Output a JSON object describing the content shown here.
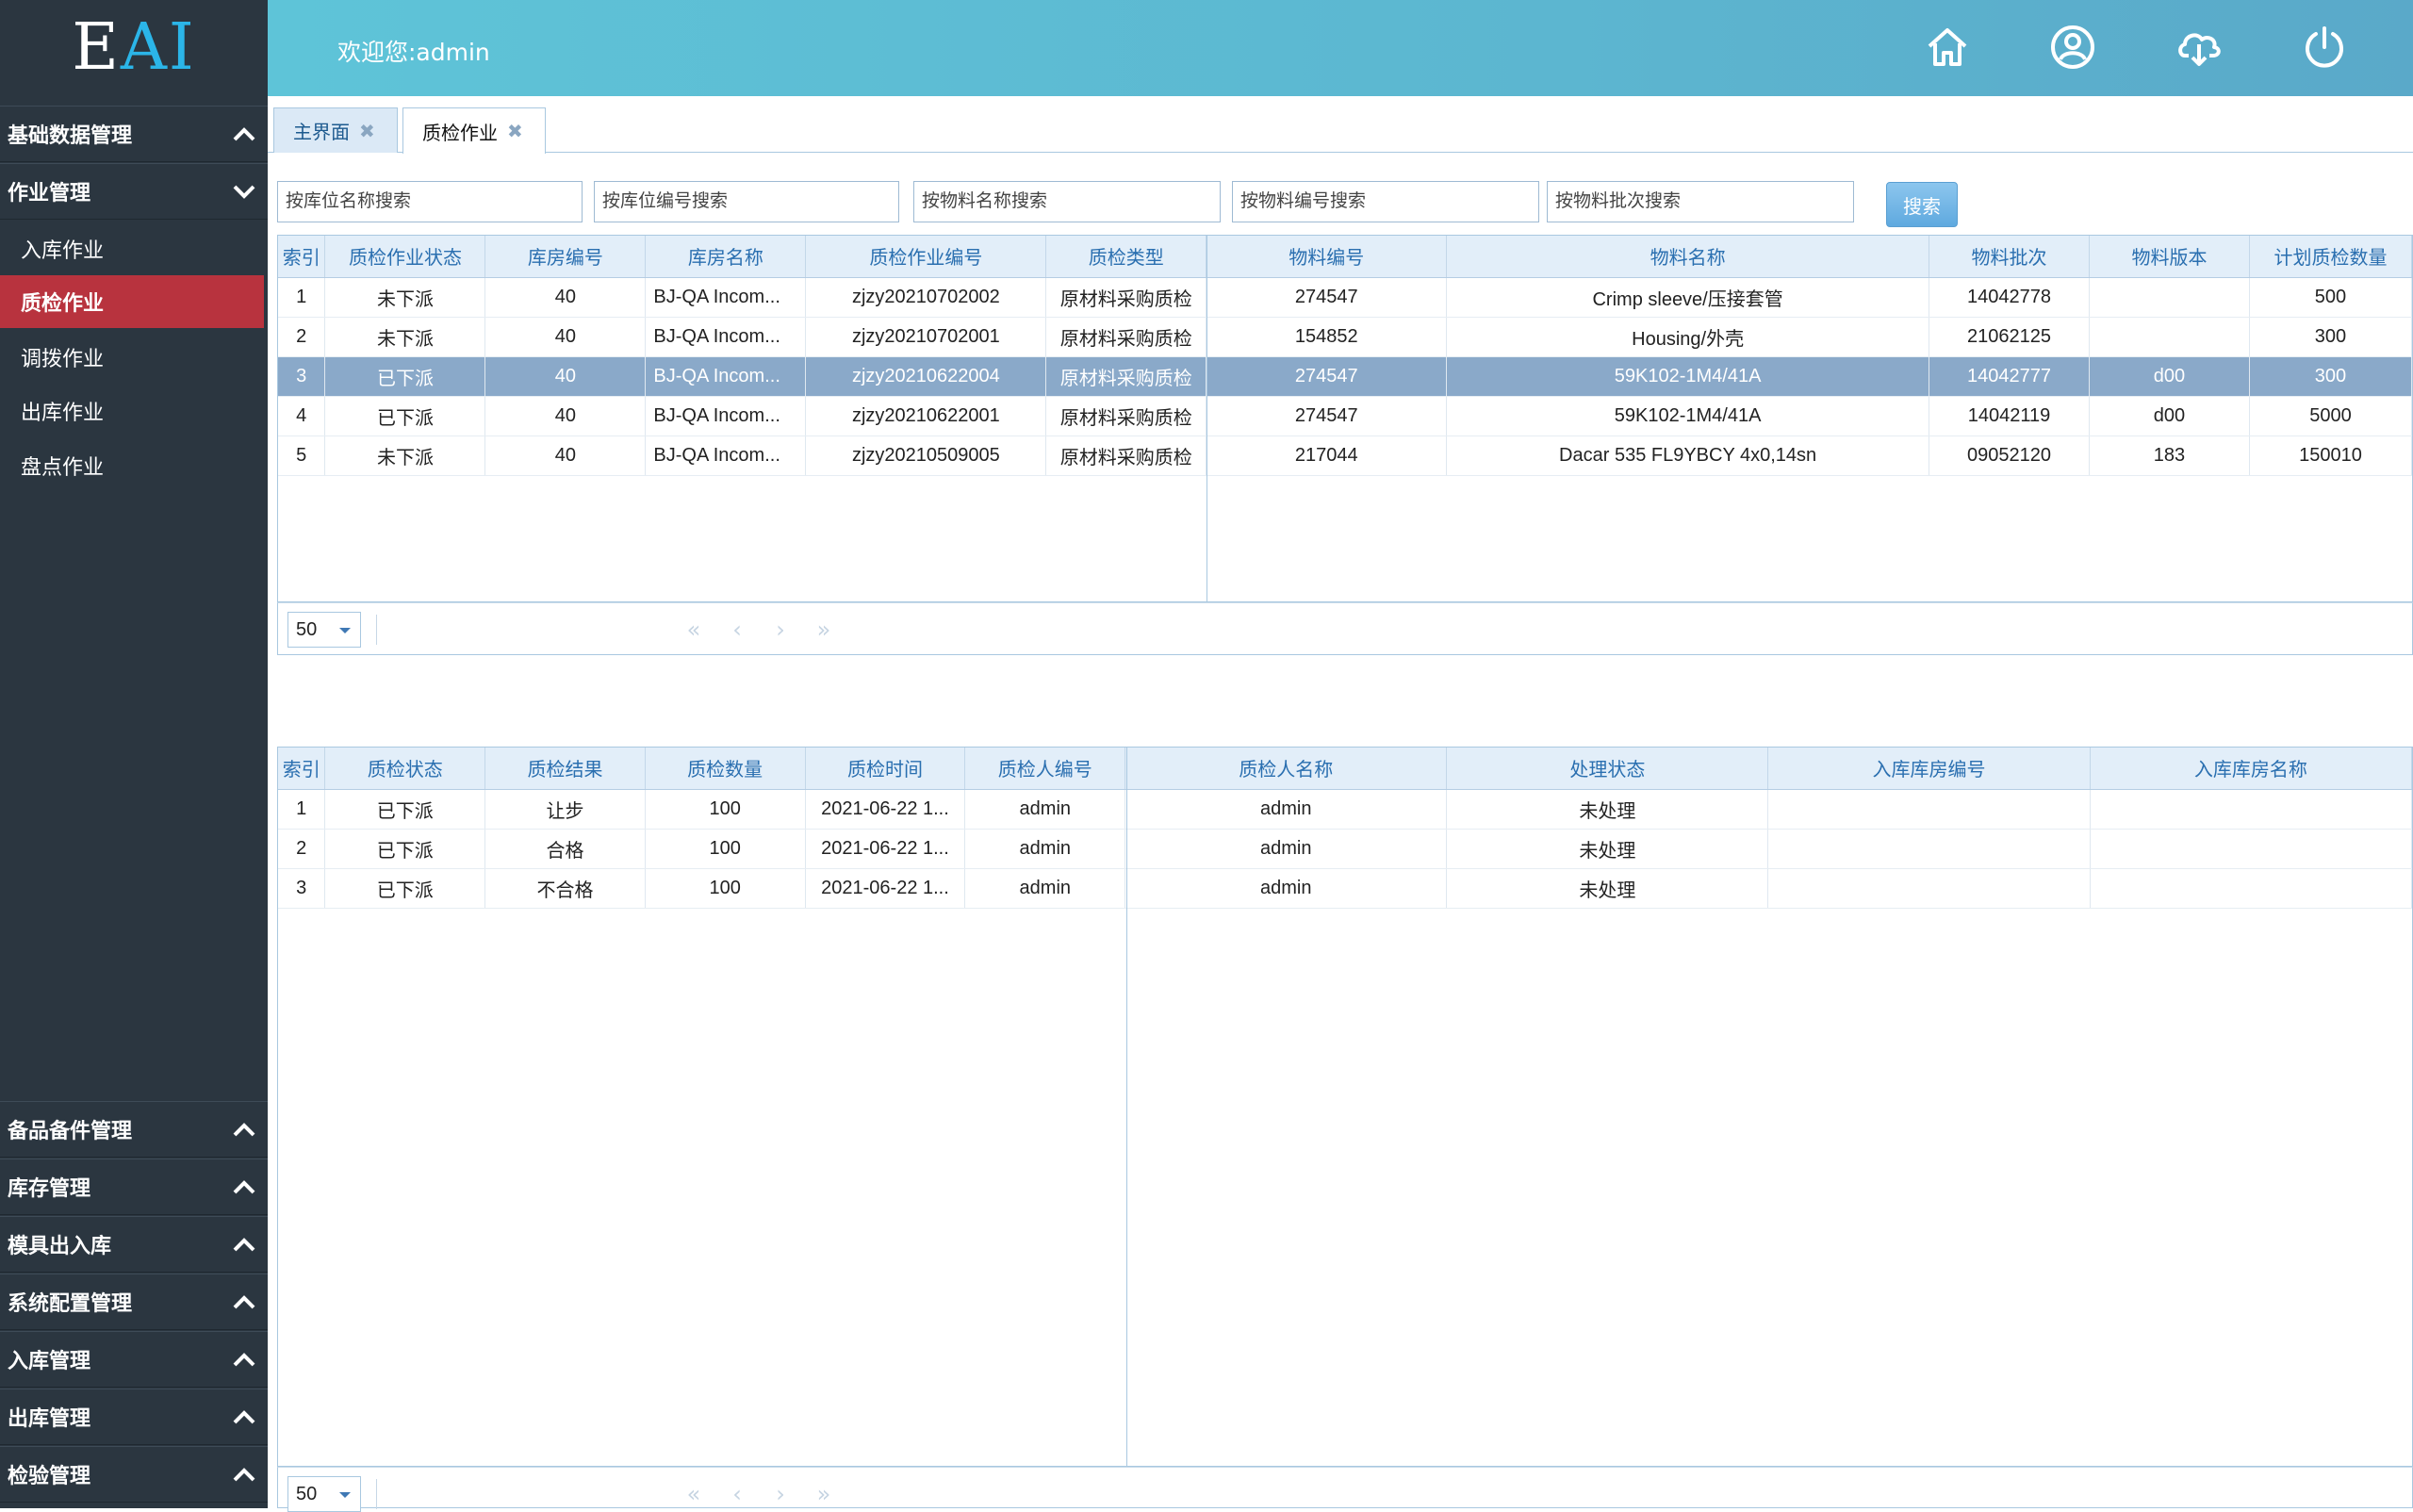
{
  "logo": {
    "e": "E",
    "ai": "AI"
  },
  "header": {
    "welcome": "欢迎您:admin"
  },
  "header_icons": [
    "home-icon",
    "user-icon",
    "cloud-download-icon",
    "power-icon"
  ],
  "sidebar": {
    "groups_top": [
      {
        "label": "基础数据管理",
        "state": "collapsed"
      },
      {
        "label": "作业管理",
        "state": "expanded"
      }
    ],
    "items": [
      {
        "label": "入库作业"
      },
      {
        "label": "质检作业",
        "active": true
      },
      {
        "label": "调拨作业"
      },
      {
        "label": "出库作业"
      },
      {
        "label": "盘点作业"
      }
    ],
    "groups_bottom": [
      {
        "label": "备品备件管理"
      },
      {
        "label": "库存管理"
      },
      {
        "label": "模具出入库"
      },
      {
        "label": "系统配置管理"
      },
      {
        "label": "入库管理"
      },
      {
        "label": "出库管理"
      },
      {
        "label": "检验管理"
      }
    ]
  },
  "tabs": [
    {
      "label": "主界面",
      "close": "✖"
    },
    {
      "label": "质检作业",
      "close": "✖"
    }
  ],
  "search": {
    "placeholders": [
      "按库位名称搜索",
      "按库位编号搜索",
      "按物料名称搜索",
      "按物料编号搜索",
      "按物料批次搜索"
    ],
    "button": "搜索"
  },
  "grid1": {
    "columns": [
      "索引",
      "质检作业状态",
      "库房编号",
      "库房名称",
      "质检作业编号",
      "质检类型",
      "物料编号",
      "物料名称",
      "物料批次",
      "物料版本",
      "计划质检数量"
    ],
    "rows": [
      [
        "1",
        "未下派",
        "40",
        "BJ-QA Incom...",
        "zjzy20210702002",
        "原材料采购质检",
        "274547",
        "Crimp sleeve/压接套管",
        "14042778",
        "",
        "500"
      ],
      [
        "2",
        "未下派",
        "40",
        "BJ-QA Incom...",
        "zjzy20210702001",
        "原材料采购质检",
        "154852",
        "Housing/外壳",
        "21062125",
        "",
        "300"
      ],
      [
        "3",
        "已下派",
        "40",
        "BJ-QA Incom...",
        "zjzy20210622004",
        "原材料采购质检",
        "274547",
        "59K102-1M4/41A",
        "14042777",
        "d00",
        "300"
      ],
      [
        "4",
        "已下派",
        "40",
        "BJ-QA Incom...",
        "zjzy20210622001",
        "原材料采购质检",
        "274547",
        "59K102-1M4/41A",
        "14042119",
        "d00",
        "5000"
      ],
      [
        "5",
        "未下派",
        "40",
        "BJ-QA Incom...",
        "zjzy20210509005",
        "原材料采购质检",
        "217044",
        "Dacar 535 FL9YBCY 4x0,14sn",
        "09052120",
        "183",
        "150010"
      ]
    ],
    "selected_row": 3,
    "page_size": "50"
  },
  "grid2": {
    "columns": [
      "索引",
      "质检状态",
      "质检结果",
      "质检数量",
      "质检时间",
      "质检人编号",
      "质检人名称",
      "处理状态",
      "入库库房编号",
      "入库库房名称"
    ],
    "rows": [
      [
        "1",
        "已下派",
        "让步",
        "100",
        "2021-06-22 1...",
        "admin",
        "admin",
        "未处理",
        "",
        ""
      ],
      [
        "2",
        "已下派",
        "合格",
        "100",
        "2021-06-22 1...",
        "admin",
        "admin",
        "未处理",
        "",
        ""
      ],
      [
        "3",
        "已下派",
        "不合格",
        "100",
        "2021-06-22 1...",
        "admin",
        "admin",
        "未处理",
        "",
        ""
      ]
    ],
    "page_size": "50"
  },
  "pager_buttons": [
    "«",
    "‹",
    "›",
    "»"
  ],
  "colors": {
    "sidebar": "#2b3640",
    "active_item": "#b8333e",
    "header": "#5cb6d0",
    "grid_header": "#e2eef9",
    "selected_row": "#8aa9c9"
  }
}
